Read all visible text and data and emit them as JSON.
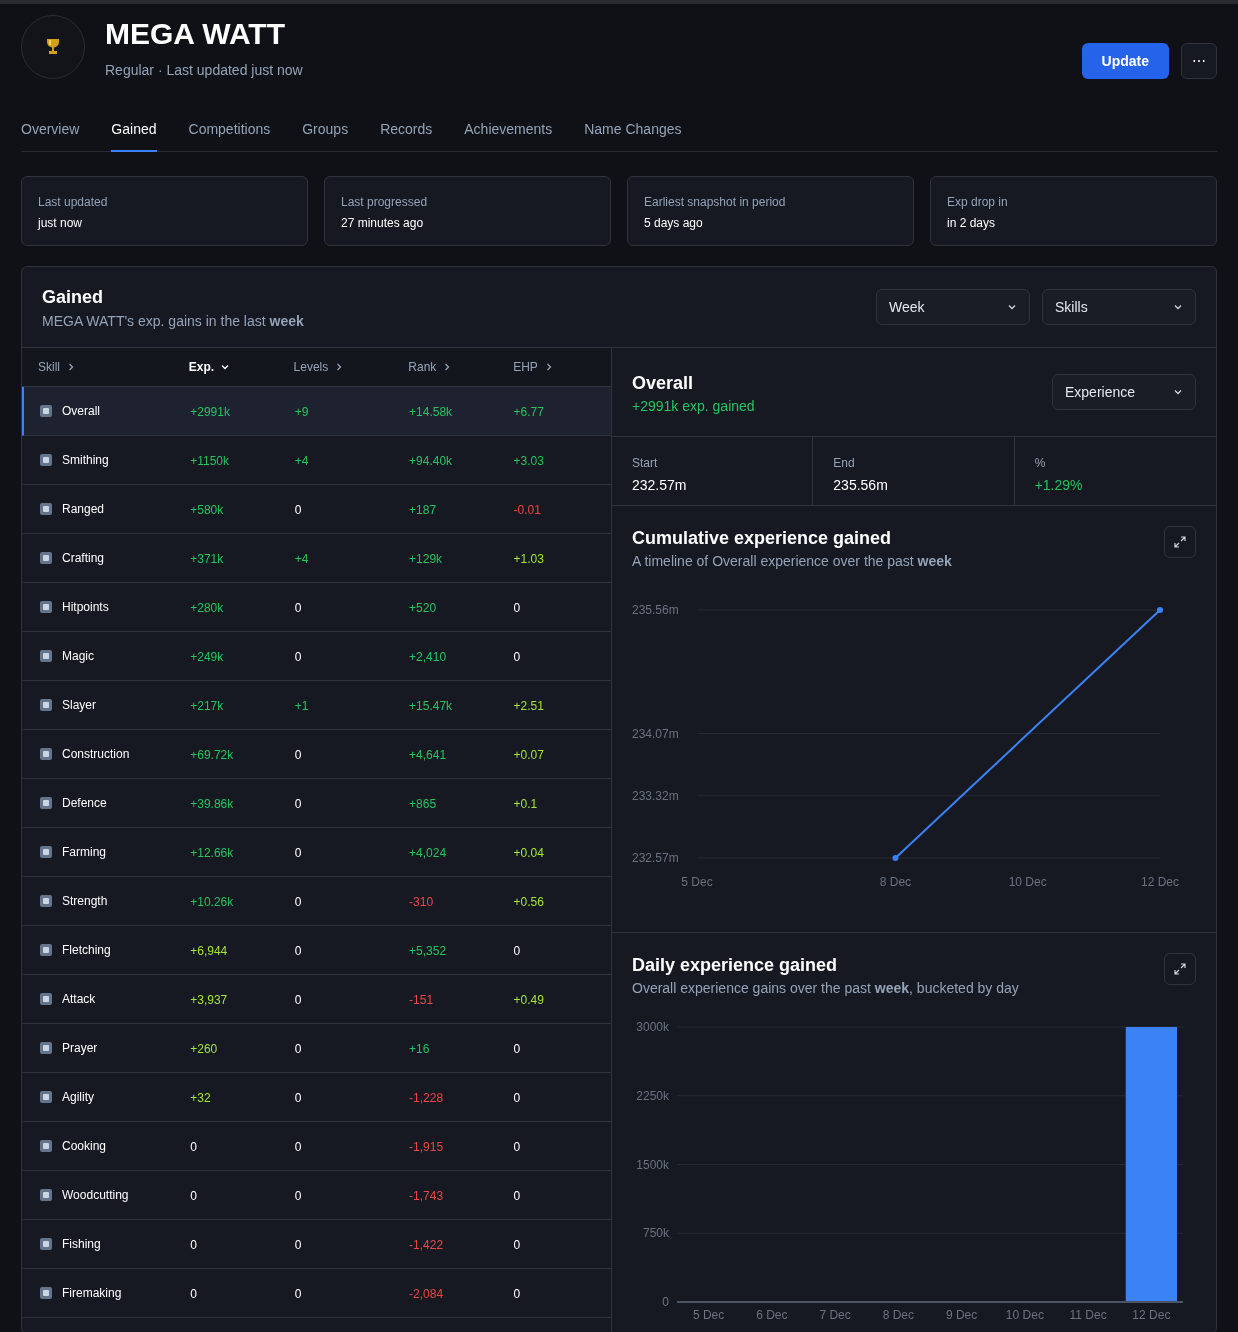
{
  "player": {
    "name": "MEGA WATT",
    "subtitle": "Regular · Last updated just now"
  },
  "actions": {
    "update": "Update",
    "more": "⋯"
  },
  "tabs": [
    {
      "label": "Overview",
      "selected": false
    },
    {
      "label": "Gained",
      "selected": true
    },
    {
      "label": "Competitions",
      "selected": false
    },
    {
      "label": "Groups",
      "selected": false
    },
    {
      "label": "Records",
      "selected": false
    },
    {
      "label": "Achievements",
      "selected": false
    },
    {
      "label": "Name Changes",
      "selected": false
    }
  ],
  "info_cards": [
    {
      "label": "Last updated",
      "value": "just now"
    },
    {
      "label": "Last progressed",
      "value": "27 minutes ago"
    },
    {
      "label": "Earliest snapshot in period",
      "value": "5 days ago"
    },
    {
      "label": "Exp drop in",
      "value": "in 2 days"
    }
  ],
  "gained": {
    "title": "Gained",
    "subtitle": "MEGA WATT's exp. gains in the last **week**",
    "period_select": "Week",
    "metric_select": "Skills"
  },
  "table": {
    "columns": [
      {
        "label": "Skill",
        "sorted": false
      },
      {
        "label": "Exp.",
        "sorted": true
      },
      {
        "label": "Levels",
        "sorted": false
      },
      {
        "label": "Rank",
        "sorted": false
      },
      {
        "label": "EHP",
        "sorted": false
      }
    ],
    "rows": [
      {
        "selected": true,
        "cells": [
          {
            "text": "Overall"
          },
          {
            "text": "+2991k",
            "color": "#22c55e"
          },
          {
            "text": "+9",
            "color": "#22c55e"
          },
          {
            "text": "+14.58k",
            "color": "#22c55e"
          },
          {
            "text": "+6.77",
            "color": "#22c55e"
          }
        ]
      },
      {
        "selected": false,
        "cells": [
          {
            "text": "Smithing"
          },
          {
            "text": "+1150k",
            "color": "#22c55e"
          },
          {
            "text": "+4",
            "color": "#22c55e"
          },
          {
            "text": "+94.40k",
            "color": "#22c55e"
          },
          {
            "text": "+3.03",
            "color": "#22c55e"
          }
        ]
      },
      {
        "selected": false,
        "cells": [
          {
            "text": "Ranged"
          },
          {
            "text": "+580k",
            "color": "#22c55e"
          },
          {
            "text": "0"
          },
          {
            "text": "+187",
            "color": "#22c55e"
          },
          {
            "text": "-0.01",
            "color": "#ef4444"
          }
        ]
      },
      {
        "selected": false,
        "cells": [
          {
            "text": "Crafting"
          },
          {
            "text": "+371k",
            "color": "#22c55e"
          },
          {
            "text": "+4",
            "color": "#22c55e"
          },
          {
            "text": "+129k",
            "color": "#22c55e"
          },
          {
            "text": "+1.03",
            "color": "#a3e635"
          }
        ]
      },
      {
        "selected": false,
        "cells": [
          {
            "text": "Hitpoints"
          },
          {
            "text": "+280k",
            "color": "#22c55e"
          },
          {
            "text": "0"
          },
          {
            "text": "+520",
            "color": "#22c55e"
          },
          {
            "text": "0"
          }
        ]
      },
      {
        "selected": false,
        "cells": [
          {
            "text": "Magic"
          },
          {
            "text": "+249k",
            "color": "#22c55e"
          },
          {
            "text": "0"
          },
          {
            "text": "+2,410",
            "color": "#22c55e"
          },
          {
            "text": "0"
          }
        ]
      },
      {
        "selected": false,
        "cells": [
          {
            "text": "Slayer"
          },
          {
            "text": "+217k",
            "color": "#22c55e"
          },
          {
            "text": "+1",
            "color": "#22c55e"
          },
          {
            "text": "+15.47k",
            "color": "#22c55e"
          },
          {
            "text": "+2.51",
            "color": "#a3e635"
          }
        ]
      },
      {
        "selected": false,
        "cells": [
          {
            "text": "Construction"
          },
          {
            "text": "+69.72k",
            "color": "#22c55e"
          },
          {
            "text": "0"
          },
          {
            "text": "+4,641",
            "color": "#22c55e"
          },
          {
            "text": "+0.07",
            "color": "#a3e635"
          }
        ]
      },
      {
        "selected": false,
        "cells": [
          {
            "text": "Defence"
          },
          {
            "text": "+39.86k",
            "color": "#22c55e"
          },
          {
            "text": "0"
          },
          {
            "text": "+865",
            "color": "#22c55e"
          },
          {
            "text": "+0.1",
            "color": "#a3e635"
          }
        ]
      },
      {
        "selected": false,
        "cells": [
          {
            "text": "Farming"
          },
          {
            "text": "+12.66k",
            "color": "#22c55e"
          },
          {
            "text": "0"
          },
          {
            "text": "+4,024",
            "color": "#22c55e"
          },
          {
            "text": "+0.04",
            "color": "#a3e635"
          }
        ]
      },
      {
        "selected": false,
        "cells": [
          {
            "text": "Strength"
          },
          {
            "text": "+10.26k",
            "color": "#22c55e"
          },
          {
            "text": "0"
          },
          {
            "text": "-310",
            "color": "#ef4444"
          },
          {
            "text": "+0.56",
            "color": "#a3e635"
          }
        ]
      },
      {
        "selected": false,
        "cells": [
          {
            "text": "Fletching"
          },
          {
            "text": "+6,944",
            "color": "#a3e635"
          },
          {
            "text": "0"
          },
          {
            "text": "+5,352",
            "color": "#22c55e"
          },
          {
            "text": "0"
          }
        ]
      },
      {
        "selected": false,
        "cells": [
          {
            "text": "Attack"
          },
          {
            "text": "+3,937",
            "color": "#a3e635"
          },
          {
            "text": "0"
          },
          {
            "text": "-151",
            "color": "#ef4444"
          },
          {
            "text": "+0.49",
            "color": "#a3e635"
          }
        ]
      },
      {
        "selected": false,
        "cells": [
          {
            "text": "Prayer"
          },
          {
            "text": "+260",
            "color": "#a3e635"
          },
          {
            "text": "0"
          },
          {
            "text": "+16",
            "color": "#22c55e"
          },
          {
            "text": "0"
          }
        ]
      },
      {
        "selected": false,
        "cells": [
          {
            "text": "Agility"
          },
          {
            "text": "+32",
            "color": "#a3e635"
          },
          {
            "text": "0"
          },
          {
            "text": "-1,228",
            "color": "#ef4444"
          },
          {
            "text": "0"
          }
        ]
      },
      {
        "selected": false,
        "cells": [
          {
            "text": "Cooking"
          },
          {
            "text": "0"
          },
          {
            "text": "0"
          },
          {
            "text": "-1,915",
            "color": "#ef4444"
          },
          {
            "text": "0"
          }
        ]
      },
      {
        "selected": false,
        "cells": [
          {
            "text": "Woodcutting"
          },
          {
            "text": "0"
          },
          {
            "text": "0"
          },
          {
            "text": "-1,743",
            "color": "#ef4444"
          },
          {
            "text": "0"
          }
        ]
      },
      {
        "selected": false,
        "cells": [
          {
            "text": "Fishing"
          },
          {
            "text": "0"
          },
          {
            "text": "0"
          },
          {
            "text": "-1,422",
            "color": "#ef4444"
          },
          {
            "text": "0"
          }
        ]
      },
      {
        "selected": false,
        "cells": [
          {
            "text": "Firemaking"
          },
          {
            "text": "0"
          },
          {
            "text": "0"
          },
          {
            "text": "-2,084",
            "color": "#ef4444"
          },
          {
            "text": "0"
          }
        ]
      }
    ]
  },
  "detail": {
    "title": "Overall",
    "gained": "+2991k exp. gained",
    "metric_select": "Experience",
    "stats": [
      {
        "label": "Start",
        "value": "232.57m"
      },
      {
        "label": "End",
        "value": "235.56m"
      },
      {
        "label": "%",
        "value": "+1.29%",
        "color": "#22c55e"
      }
    ],
    "cumulative": {
      "title": "Cumulative experience gained",
      "subtitle": "A timeline of Overall experience over the past **week**",
      "chart_data": {
        "type": "line",
        "grid": true,
        "categories": [
          "5 Dec",
          null,
          null,
          "8 Dec",
          null,
          "10 Dec",
          null,
          "12 Dec"
        ],
        "ylim": [
          232.57,
          235.56
        ],
        "yticks": [
          {
            "value": 232.57,
            "label": "232.57m"
          },
          {
            "value": 233.32,
            "label": "233.32m"
          },
          {
            "value": 234.07,
            "label": "234.07m"
          },
          {
            "value": 235.56,
            "label": "235.56m"
          }
        ],
        "series": [
          {
            "color": "#3b82f6",
            "marker": true,
            "values": [
              null,
              null,
              null,
              232.57,
              null,
              null,
              null,
              235.56
            ]
          }
        ]
      }
    },
    "daily": {
      "title": "Daily experience gained",
      "subtitle": "Overall experience gains over the past **week**, bucketed by day",
      "chart_data": {
        "type": "bar",
        "grid": true,
        "categories": [
          "5 Dec",
          "6 Dec",
          "7 Dec",
          "8 Dec",
          "9 Dec",
          "10 Dec",
          "11 Dec",
          "12 Dec"
        ],
        "ylim": [
          0,
          3000
        ],
        "yticks": [
          {
            "value": 0,
            "label": "0"
          },
          {
            "value": 750,
            "label": "750k"
          },
          {
            "value": 1500,
            "label": "1500k"
          },
          {
            "value": 2250,
            "label": "2250k"
          },
          {
            "value": 3000,
            "label": "3000k"
          }
        ],
        "series": [
          {
            "color": "#3b82f6",
            "values": [
              0,
              0,
              0,
              0,
              0,
              0,
              0,
              3000
            ]
          }
        ]
      }
    }
  }
}
